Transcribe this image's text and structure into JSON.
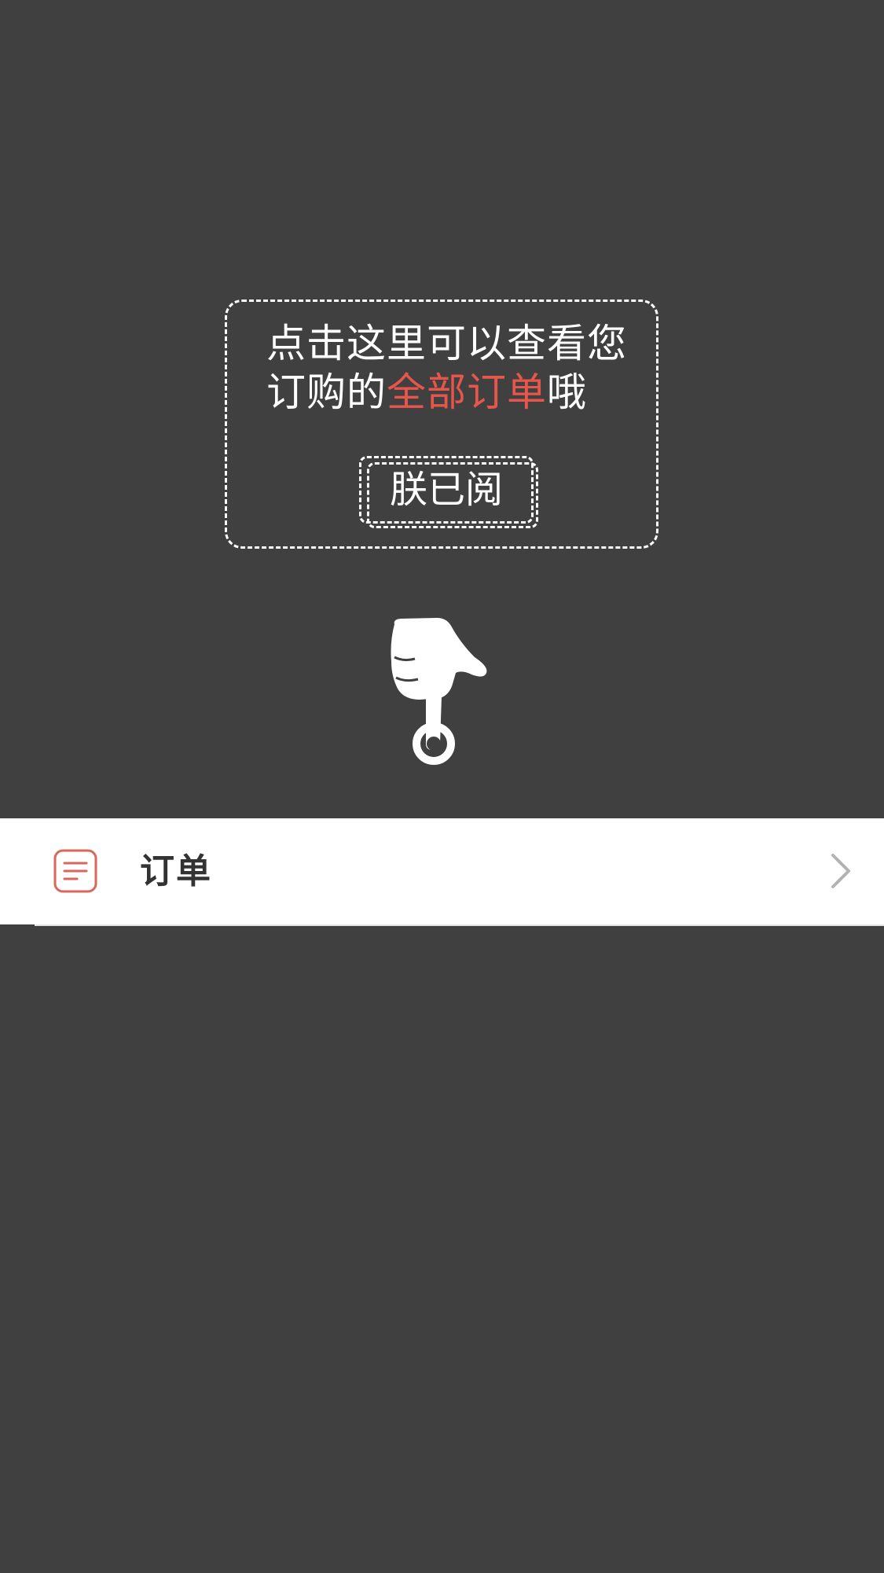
{
  "tip": {
    "line1": "点击这里可以查看您",
    "line2_prefix": "订购的",
    "line2_highlight": "全部订单",
    "line2_suffix": "哦",
    "acknowledge_label": "朕已阅"
  },
  "icons": {
    "pointer": "pointing-hand-icon",
    "order": "order-list-icon",
    "chevron": "chevron-right-icon"
  },
  "order_row": {
    "label": "订单"
  },
  "colors": {
    "overlay": "#404040",
    "highlight": "#e8554b",
    "order_icon": "#d9675c"
  }
}
